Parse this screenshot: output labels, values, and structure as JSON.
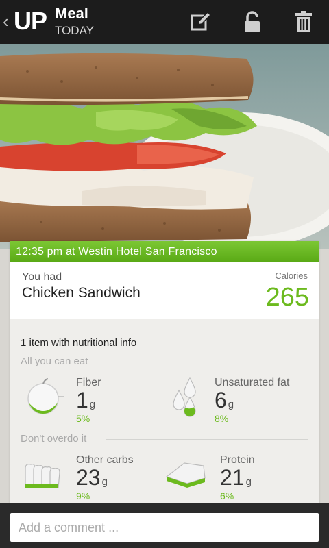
{
  "header": {
    "logo": "UP",
    "title": "Meal",
    "subtitle": "TODAY",
    "icons": [
      "back-chevron-icon",
      "edit-icon",
      "unlock-icon",
      "trash-icon"
    ]
  },
  "meal": {
    "banner": "12:35 pm at Westin Hotel San Francisco",
    "you_had_label": "You had",
    "name": "Chicken Sandwich",
    "calories_label": "Calories",
    "calories": "265"
  },
  "nutrition": {
    "summary": "1 item with nutritional info",
    "sections": [
      {
        "label": "All you can eat",
        "items": [
          {
            "name": "Fiber",
            "value": "1",
            "unit": "g",
            "percent": "5%",
            "icon": "apple-icon"
          },
          {
            "name": "Unsaturated fat",
            "value": "6",
            "unit": "g",
            "percent": "8%",
            "icon": "oil-drops-icon"
          }
        ]
      },
      {
        "label": "Don't overdo it",
        "items": [
          {
            "name": "Other carbs",
            "value": "23",
            "unit": "g",
            "percent": "9%",
            "icon": "bread-slices-icon"
          },
          {
            "name": "Protein",
            "value": "21",
            "unit": "g",
            "percent": "6%",
            "icon": "meat-icon"
          }
        ]
      }
    ]
  },
  "comment": {
    "placeholder": "Add a comment ..."
  },
  "colors": {
    "accent_green": "#6cba1e",
    "header_bg": "#1c1c1c",
    "banner_green": "#62b01c"
  }
}
